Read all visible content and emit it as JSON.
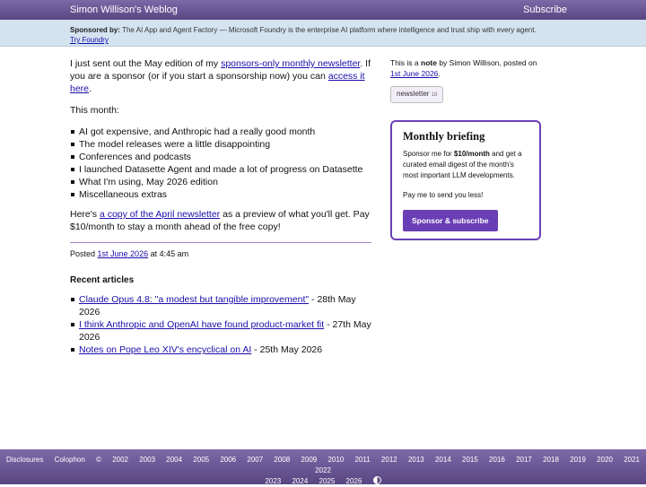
{
  "header": {
    "site_title": "Simon Willison's Weblog",
    "subscribe_label": "Subscribe"
  },
  "sponsor": {
    "prefix": "Sponsored by:",
    "text": " The AI App and Agent Factory — Microsoft Foundry is the enterprise AI platform where intelligence and trust ship with every agent.",
    "link": "Try Foundry"
  },
  "note": {
    "intro_1": "I just sent out the May edition of my ",
    "intro_link_1": "sponsors-only monthly newsletter",
    "intro_2": ". If you are a sponsor (or if you start a sponsorship now) you can ",
    "intro_link_2": "access it here",
    "intro_3": ".",
    "this_month": "This month:",
    "items": [
      "AI got expensive, and Anthropic had a really good month",
      "The model releases were a little disappointing",
      "Conferences and podcasts",
      "I launched Datasette Agent and made a lot of progress on Datasette",
      "What I'm using, May 2026 edition",
      "Miscellaneous extras"
    ],
    "outro_1": "Here's ",
    "outro_link": "a copy of the April newsletter",
    "outro_2": " as a preview of what you'll get. Pay $10/month to stay a month ahead of the free copy!",
    "posted_prefix": "Posted ",
    "posted_date": "1st June 2026",
    "posted_time": " at 4:45 am"
  },
  "recent": {
    "title": "Recent articles",
    "items": [
      {
        "title": "Claude Opus 4.8: \"a modest but tangible improvement\"",
        "date": " - 28th May 2026"
      },
      {
        "title": "I think Anthropic and OpenAI have found product-market fit",
        "date": " - 27th May 2026"
      },
      {
        "title": "Notes on Pope Leo XIV's encyclical on AI",
        "date": " - 25th May 2026"
      }
    ]
  },
  "sidebar": {
    "meta_1": "This is a ",
    "meta_note": "note",
    "meta_2": " by Simon Willison, posted on ",
    "meta_date": "1st June 2026",
    "meta_3": ".",
    "tag": "newsletter",
    "tag_arrow": "18",
    "brief_title": "Monthly briefing",
    "brief_text_1": "Sponsor me for ",
    "brief_price": "$10/month",
    "brief_text_2": " and get a curated email digest of the month's most important LLM developments.",
    "brief_pay": "Pay me to send you less!",
    "brief_button": "Sponsor & subscribe"
  },
  "footer": {
    "links": [
      "Disclosures",
      "Colophon",
      "©",
      "2002",
      "2003",
      "2004",
      "2005",
      "2006",
      "2007",
      "2008",
      "2009",
      "2010",
      "2011",
      "2012",
      "2013",
      "2014",
      "2015",
      "2016",
      "2017",
      "2018",
      "2019",
      "2020",
      "2021",
      "2022",
      "2023",
      "2024",
      "2025",
      "2026"
    ],
    "contrast_icon": "contrast-icon"
  }
}
